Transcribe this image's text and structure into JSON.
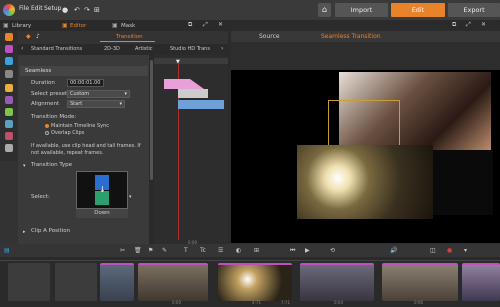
{
  "menu": {
    "file": "File",
    "edit": "Edit",
    "setup": "Setup"
  },
  "nav": {
    "import": "Import",
    "edit": "Edit",
    "export": "Export"
  },
  "tabs": {
    "library": "Library",
    "editor": "Editor",
    "mask": "Mask"
  },
  "transition_title": "Transition",
  "categories": [
    "Standard Transitions",
    "2D-3D",
    "Artistic",
    "Studio HD Trans"
  ],
  "settings": {
    "section": "Seamless",
    "duration_label": "Duration",
    "duration_value": "00:00:01.00",
    "preset_label": "Select preset",
    "preset_value": "Custom",
    "alignment_label": "Alignment",
    "alignment_value": "Start",
    "mode_label": "Transition Mode:",
    "mode_opt1": "Maintain Timeline Sync",
    "mode_opt2": "Overlap Clips",
    "note": "If available, use clip head and tail frames. If not available, repeat frames.",
    "type_header": "Transition Type",
    "select_label": "Select:",
    "type_value": "Down",
    "clip_a_header": "Clip A Position"
  },
  "preview_tabs": {
    "source": "Source",
    "seamless": "Seamless Transition"
  },
  "timeline_tc": "0:00",
  "strip_tcs": [
    "0:00",
    "4:71",
    "7:71",
    "0:04",
    "0:06"
  ],
  "colors": {
    "accent": "#e8832a",
    "magenta": "#c04fc0",
    "active_tab": "#e8832a"
  }
}
